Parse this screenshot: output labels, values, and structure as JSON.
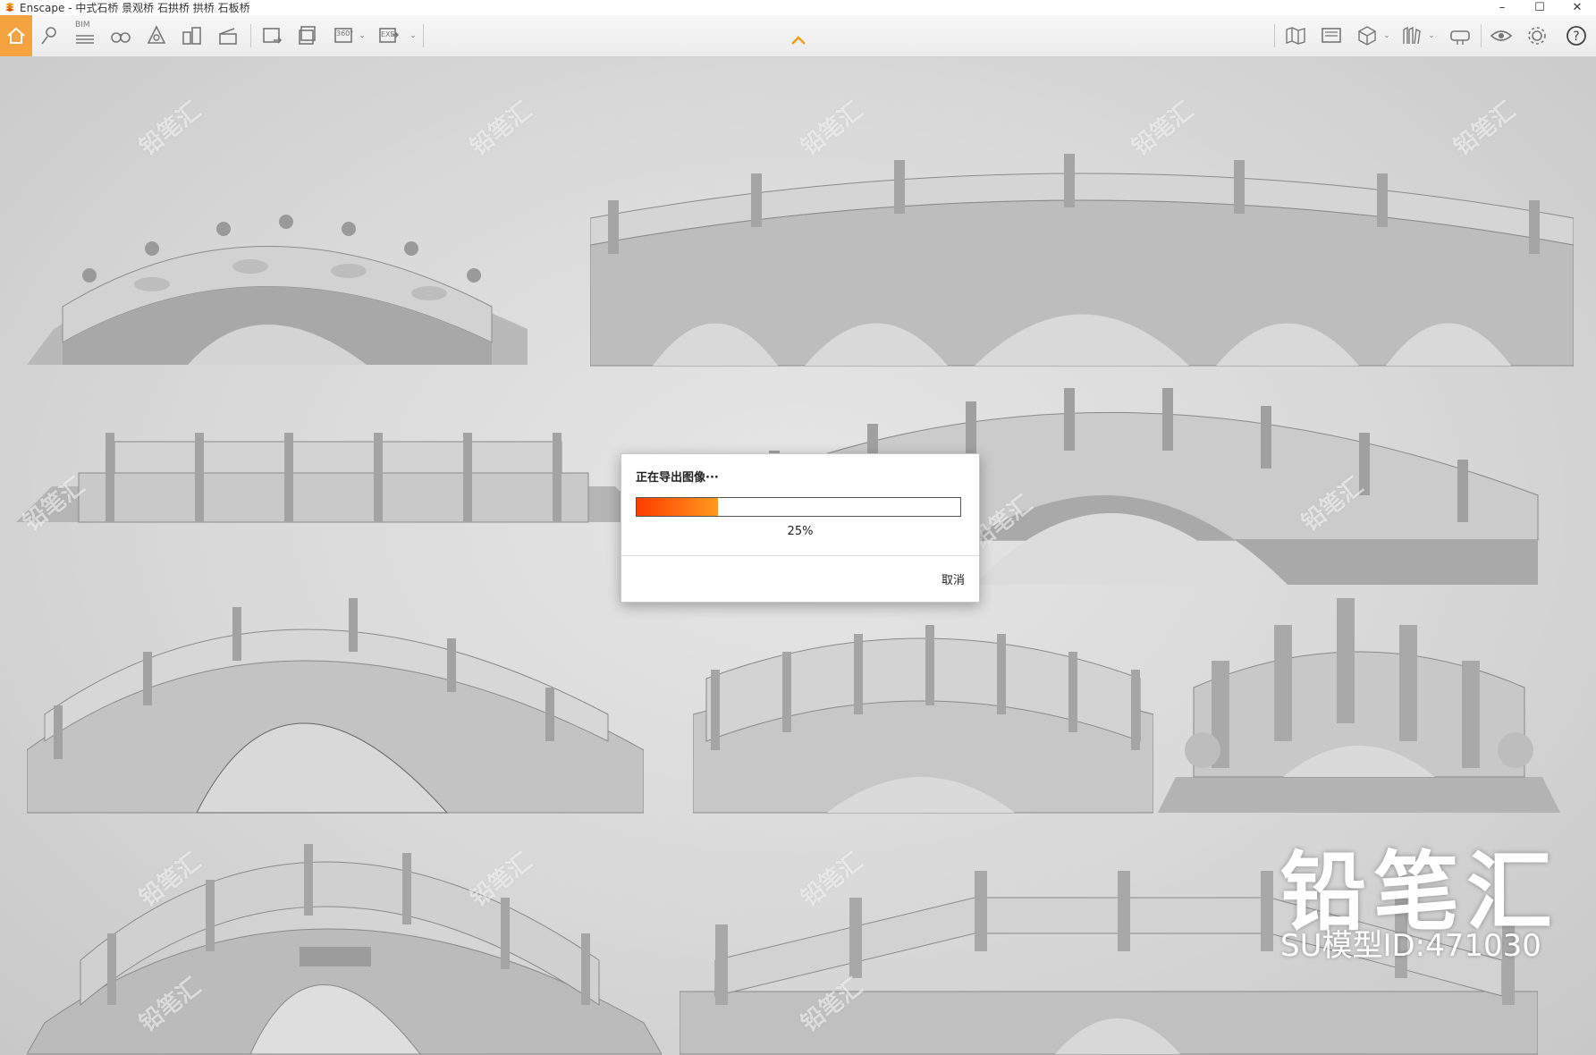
{
  "window": {
    "title": "Enscape - 中式石桥 景观桥 石拱桥 拱桥 石板桥"
  },
  "toolbar": {
    "bim_label": "BIM",
    "pano_label": "360°",
    "exe_label": "EXE",
    "accent_color": "#f39c12"
  },
  "dialog": {
    "title": "正在导出图像···",
    "progress": 25,
    "progress_text": "25%",
    "cancel_label": "取消",
    "bar_start_color": "#ff3c00",
    "bar_end_color": "#ff9a1e"
  },
  "watermark": {
    "brand": "铅笔汇",
    "model_id": "SU模型ID:471030"
  }
}
